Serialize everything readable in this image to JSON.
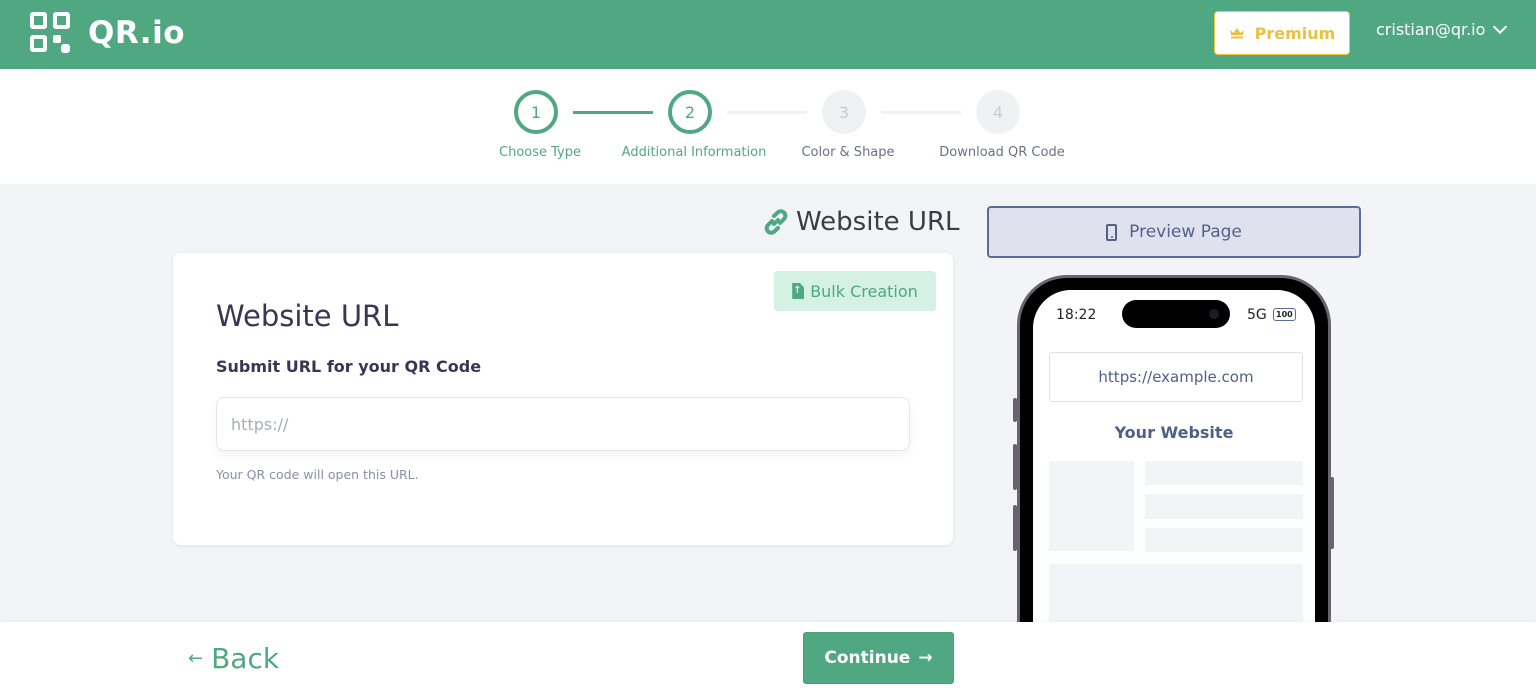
{
  "header": {
    "brand": "QR.io",
    "premium_label": "Premium",
    "user_email": "cristian@qr.io",
    "brand_color": "#50a882",
    "premium_color": "#ecc043"
  },
  "stepper": {
    "steps": [
      {
        "number": "1",
        "label": "Choose Type",
        "state": "completed"
      },
      {
        "number": "2",
        "label": "Additional Information",
        "state": "current"
      },
      {
        "number": "3",
        "label": "Color & Shape",
        "state": "upcoming"
      },
      {
        "number": "4",
        "label": "Download QR Code",
        "state": "upcoming"
      }
    ]
  },
  "section": {
    "title": "Website URL",
    "icon": "link-icon",
    "preview_label": "Preview Page"
  },
  "card": {
    "bulk_label": "Bulk Creation",
    "title": "Website URL",
    "field_label": "Submit URL for your QR Code",
    "input_value": "",
    "input_placeholder": "https://",
    "hint": "Your QR code will open this URL."
  },
  "phone": {
    "time": "18:22",
    "signal": "5G",
    "battery": "100",
    "address": "https://example.com",
    "site_title": "Your Website"
  },
  "footer": {
    "back_label": "Back",
    "continue_label": "Continue"
  }
}
